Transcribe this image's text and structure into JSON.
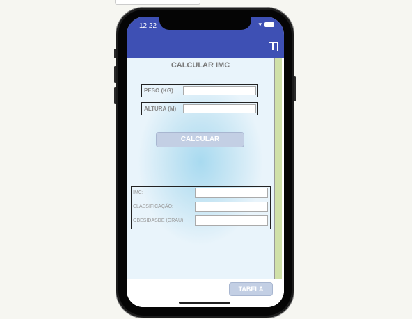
{
  "status": {
    "time": "12:22"
  },
  "app": {
    "title": "CALCULAR IMC",
    "fields": [
      {
        "label": "PESO (KG)",
        "value": ""
      },
      {
        "label": "ALTURA (M)",
        "value": ""
      }
    ],
    "calculate_label": "CALCULAR",
    "results": [
      {
        "label": "IMC:",
        "value": ""
      },
      {
        "label": "CLASSIFICAÇÃO:",
        "value": ""
      },
      {
        "label": "OBESIDASDE (GRAU):",
        "value": ""
      }
    ],
    "table_label": "TABELA"
  },
  "colors": {
    "header": "#3e50b4",
    "button": "#c3cfe4",
    "scrollbar": "#d0e0a8"
  }
}
